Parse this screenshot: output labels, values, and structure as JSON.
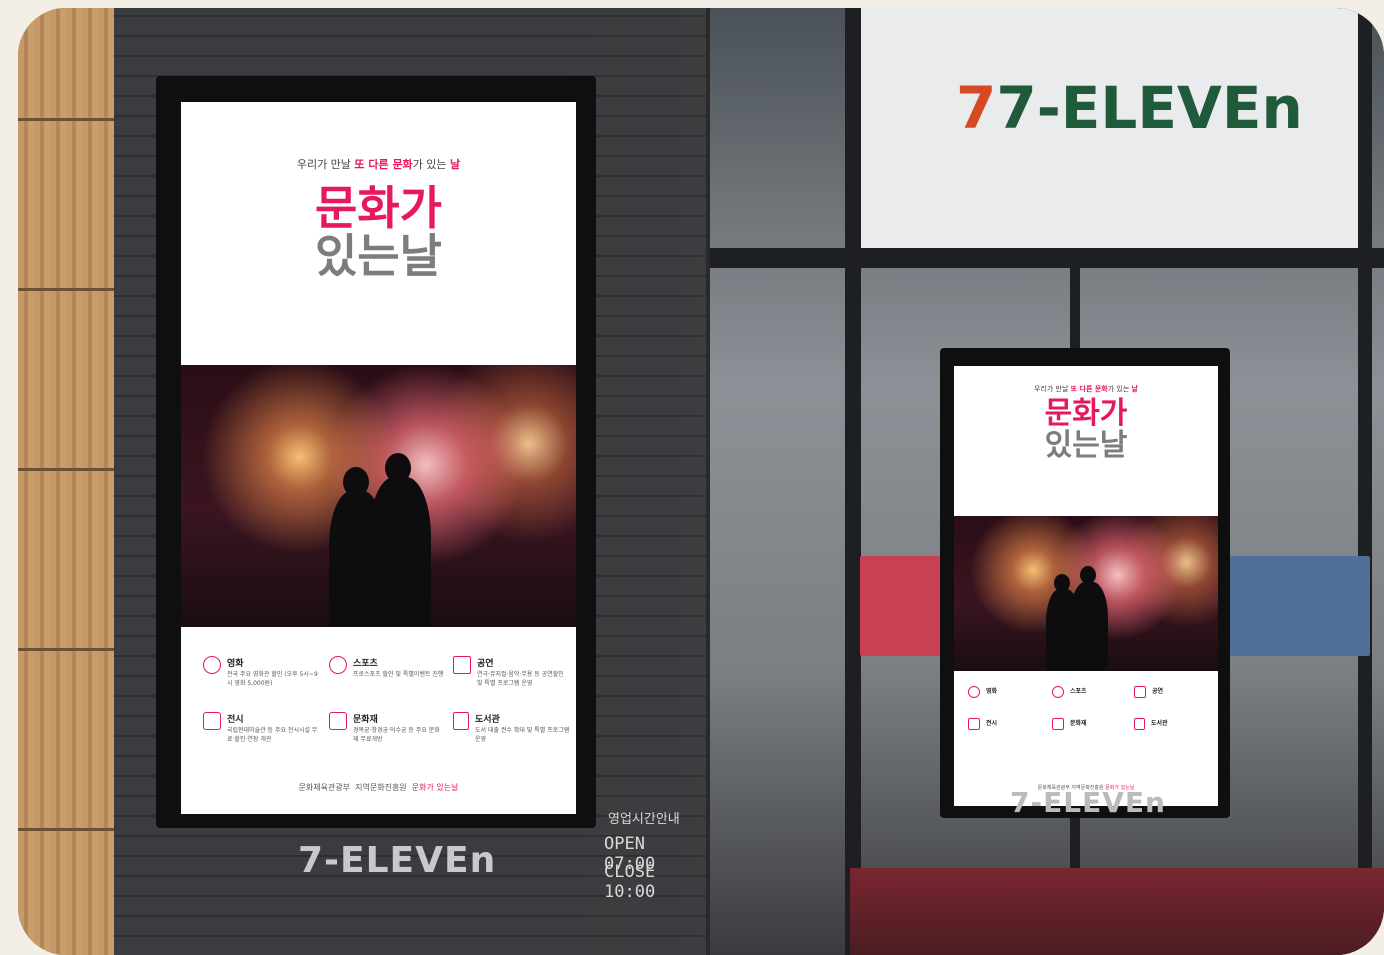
{
  "store_name": "7-ELEVEn",
  "store_name_bottom": "7-ELEVEn",
  "left_window": {
    "hours_label_top": "영업시간안내",
    "hours_open": "OPEN 07:00",
    "hours_close": "CLOSE 10:00"
  },
  "poster": {
    "tagline_pre": "우리가 만날 ",
    "tagline_hl1": "또 다른 문화",
    "tagline_mid": "가 있는 ",
    "tagline_hl2": "날",
    "logo_line1": "문화가",
    "logo_line2": "있는날",
    "services": [
      {
        "icon": "film-reel-icon",
        "title": "영화",
        "desc": "전국 주요 영화관 할인 (오후 5시~9시 영화 5,000원)"
      },
      {
        "icon": "baseball-icon",
        "title": "스포츠",
        "desc": "프로스포츠 할인 및 특별이벤트 진행"
      },
      {
        "icon": "piano-icon",
        "title": "공연",
        "desc": "연극·뮤지컬·음악·무용 등 공연할인 및 특별 프로그램 운영"
      },
      {
        "icon": "museum-icon",
        "title": "전시",
        "desc": "국립현대미술관 등 주요 전시시설 무료·할인·연장 개관"
      },
      {
        "icon": "palace-icon",
        "title": "문화재",
        "desc": "경복궁·창경궁·덕수궁 등 주요 문화재 무료개방"
      },
      {
        "icon": "book-icon",
        "title": "도서관",
        "desc": "도서 대출 권수 확대 및 특별 프로그램 운영"
      }
    ],
    "footer_org1": "문화체육관광부",
    "footer_org2": "지역문화진흥원",
    "footer_org3": "문화가 있는날"
  },
  "colors": {
    "accent": "#e6195c",
    "grey": "#7d7d7d",
    "sign_green": "#1f5a3a",
    "sign_orange": "#d44a22"
  }
}
